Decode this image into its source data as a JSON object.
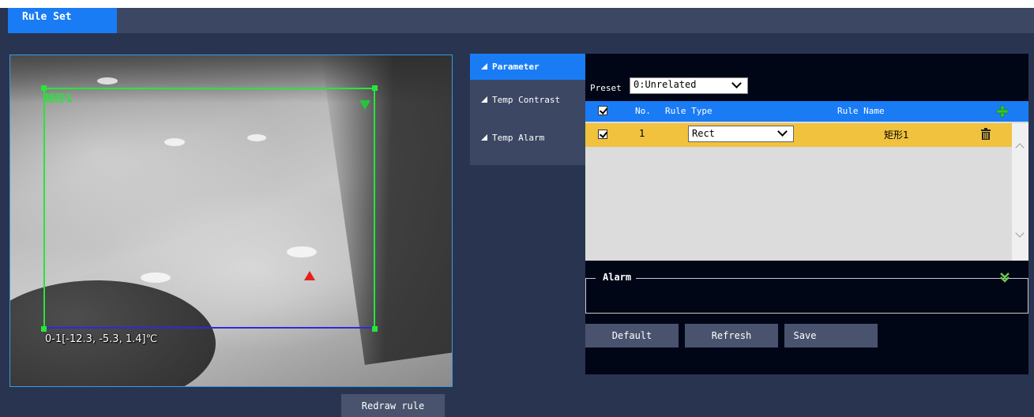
{
  "tabs": {
    "active_label": "Rule Set"
  },
  "video": {
    "rule_label": "矩形1",
    "temp_readout": "0-1[-12.3, -5.3, 1.4]℃",
    "redraw_label": "Redraw rule"
  },
  "side_nav": {
    "items": [
      {
        "label": "Parameter",
        "active": true
      },
      {
        "label": "Temp Contrast",
        "active": false
      },
      {
        "label": "Temp Alarm",
        "active": false
      }
    ]
  },
  "parameter": {
    "preset_label": "Preset",
    "preset_value": "0:Unrelated",
    "table": {
      "headers": {
        "no": "No.",
        "rule_type": "Rule Type",
        "rule_name": "Rule Name"
      },
      "rows": [
        {
          "checked": true,
          "no": "1",
          "rule_type": "Rect",
          "rule_name": "矩形1"
        }
      ]
    },
    "alarm_title": "Alarm",
    "buttons": {
      "default": "Default",
      "refresh": "Refresh",
      "save": "Save"
    }
  },
  "colors": {
    "accent": "#1a7cf5",
    "background": "#293450",
    "row_selected": "#f0c23e",
    "rule_outline": "#27e53a",
    "hot_marker": "#e8201a"
  }
}
